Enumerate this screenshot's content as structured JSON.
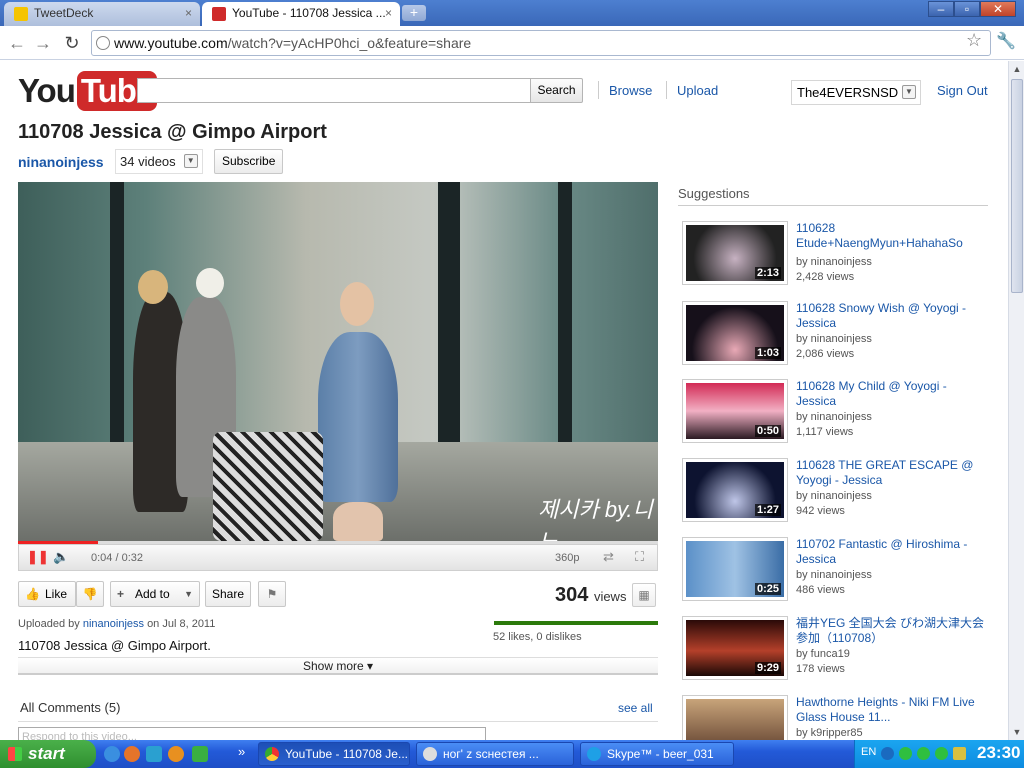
{
  "browser": {
    "tabs": [
      {
        "title": "TweetDeck",
        "close": "×"
      },
      {
        "title": "YouTube - 110708 Jessica ...",
        "close": "×"
      }
    ],
    "new_tab": "+",
    "window_buttons": {
      "minimize": "–",
      "maximize": "▫",
      "close": "✕"
    },
    "nav": {
      "back": "←",
      "forward": "→",
      "reload": "↻"
    },
    "url_host": "www.youtube.com",
    "url_path": "/watch?v=yAcHP0hci_o&feature=share",
    "star": "☆",
    "wrench": "🔧"
  },
  "header": {
    "logo_you": "You",
    "logo_tube": "Tube",
    "search_button": "Search",
    "browse": "Browse",
    "upload": "Upload",
    "username": "The4EVERSNSD",
    "sign_out": "Sign Out"
  },
  "video": {
    "title": "110708 Jessica @ Gimpo Airport",
    "channel": "ninanoinjess",
    "video_count": "34 videos",
    "subscribe": "Subscribe",
    "watermark": "제시카 by.니노",
    "time": "0:04 / 0:32",
    "quality": "360p",
    "progress": 0.125
  },
  "actions": {
    "like": "Like",
    "add_to": "Add to",
    "share": "Share",
    "views_number": "304",
    "views_label": "views"
  },
  "meta": {
    "uploaded_prefix": "Uploaded by",
    "uploader": "ninanoinjess",
    "uploaded_date": "on Jul 8, 2011",
    "likes_text": "52 likes, 0 dislikes",
    "like_ratio": 1.0,
    "description": "110708 Jessica @ Gimpo Airport.",
    "show_more": "Show more ▾"
  },
  "comments": {
    "heading": "All Comments (5)",
    "see_all": "see all",
    "placeholder": "Respond to this video..."
  },
  "suggestions": {
    "heading": "Suggestions",
    "items": [
      {
        "title": "110628 Etude+NaengMyun+HahahaSo",
        "by": "by ninanoinjess",
        "views": "2,428 views",
        "duration": "2:13"
      },
      {
        "title": "110628 Snowy Wish @ Yoyogi - Jessica",
        "by": "by ninanoinjess",
        "views": "2,086 views",
        "duration": "1:03"
      },
      {
        "title": "110628 My Child @ Yoyogi - Jessica",
        "by": "by ninanoinjess",
        "views": "1,117 views",
        "duration": "0:50"
      },
      {
        "title": "110628 THE GREAT ESCAPE @ Yoyogi - Jessica",
        "by": "by ninanoinjess",
        "views": "942 views",
        "duration": "1:27"
      },
      {
        "title": "110702 Fantastic @ Hiroshima - Jessica",
        "by": "by ninanoinjess",
        "views": "486 views",
        "duration": "0:25"
      },
      {
        "title": "福井YEG 全国大会 びわ湖大津大会参加（110708）",
        "by": "by funca19",
        "views": "178 views",
        "duration": "9:29"
      },
      {
        "title": "Hawthorne Heights - Niki FM Live Glass House 11...",
        "by": "by k9ripper85",
        "views": "",
        "duration": ""
      }
    ]
  },
  "taskbar": {
    "start": "start",
    "tasks": [
      "YouTube - 110708 Je...",
      "ног' z scнестея ...",
      "Skype™ - beer_031"
    ],
    "lang": "EN",
    "clock": "23:30",
    "more": "»"
  }
}
